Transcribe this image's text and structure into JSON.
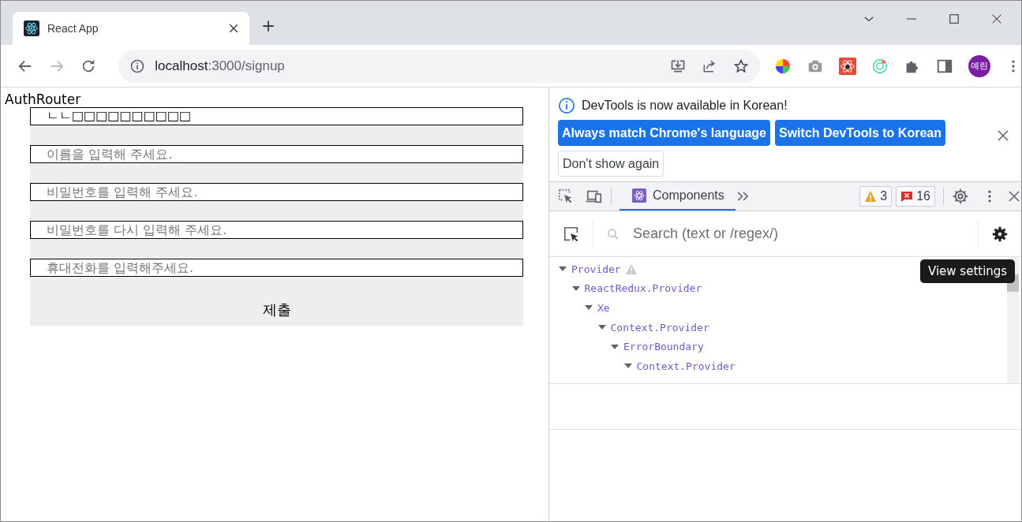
{
  "browser": {
    "tab": {
      "title": "React App"
    },
    "nav": [
      {
        "kind": "back",
        "disabled": false
      },
      {
        "kind": "forward",
        "disabled": true
      },
      {
        "kind": "reload",
        "disabled": false
      }
    ],
    "address": {
      "host": "localhost",
      "path": ":3000/signup"
    },
    "profile": {
      "initials": "예린"
    }
  },
  "page": {
    "heading": "AuthRouter",
    "fields": [
      {
        "value": "ㄴㄴ□□□□□□□□□□"
      },
      {
        "placeholder": "이름을 입력해 주세요."
      },
      {
        "placeholder": "비밀번호를 입력해 주세요."
      },
      {
        "placeholder": "비밀번호를 다시 입력해 주세요."
      },
      {
        "placeholder": "휴대전화를 입력해주세요."
      }
    ],
    "submit": "제출"
  },
  "devtools": {
    "infobar": {
      "message": "DevTools is now available in Korean!",
      "buttons": [
        {
          "label": "Always match Chrome's language",
          "kind": "primary"
        },
        {
          "label": "Switch DevTools to Korean",
          "kind": "primary"
        },
        {
          "label": "Don't show again",
          "kind": "secondary"
        }
      ]
    },
    "tabs": [
      {
        "label": "Components",
        "selected": true
      }
    ],
    "warnings": "3",
    "errors": "16",
    "search": {
      "placeholder": "Search (text or /regex/)"
    },
    "tree": [
      {
        "name": "Provider",
        "warning": true,
        "expanded": true,
        "children": [
          {
            "name": "ReactRedux.Provider",
            "expanded": true,
            "children": [
              {
                "name": "Xe",
                "expanded": true,
                "children": [
                  {
                    "name": "Context.Provider",
                    "expanded": true,
                    "children": [
                      {
                        "name": "ErrorBoundary",
                        "expanded": true,
                        "children": [
                          {
                            "name": "Context.Provider",
                            "expanded": true
                          }
                        ]
                      }
                    ]
                  }
                ]
              }
            ]
          }
        ]
      }
    ],
    "tooltip": "View settings"
  }
}
